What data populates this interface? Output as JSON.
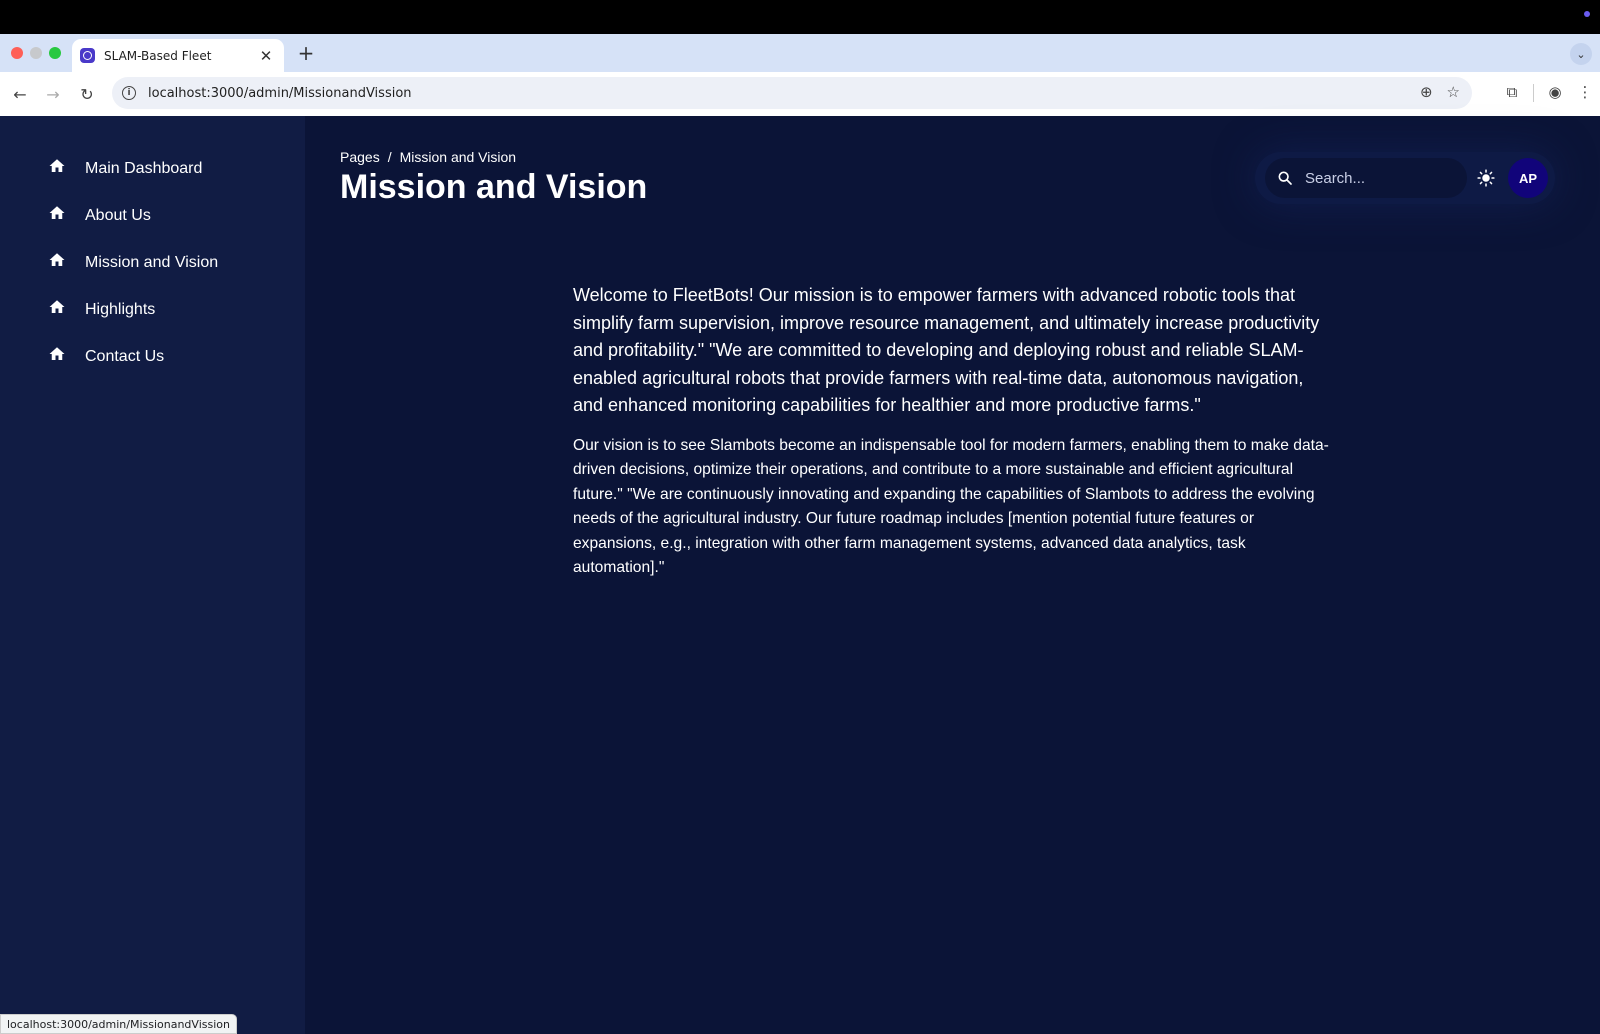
{
  "browser": {
    "tab_title": "SLAM-Based Fleet",
    "url": "localhost:3000/admin/MissionandVission",
    "status_url": "localhost:3000/admin/MissionandVission"
  },
  "sidebar": {
    "items": [
      {
        "label": "Main Dashboard",
        "icon": "home-icon"
      },
      {
        "label": "About Us",
        "icon": "home-icon"
      },
      {
        "label": "Mission and Vision",
        "icon": "home-icon"
      },
      {
        "label": "Highlights",
        "icon": "home-icon"
      },
      {
        "label": "Contact Us",
        "icon": "home-icon"
      }
    ]
  },
  "header": {
    "breadcrumb_root": "Pages",
    "breadcrumb_sep": "/",
    "breadcrumb_current": "Mission and Vision",
    "title": "Mission and Vision"
  },
  "search": {
    "placeholder": "Search..."
  },
  "user": {
    "initials": "AP"
  },
  "content": {
    "mission": "Welcome to FleetBots! Our mission is to empower farmers with advanced robotic tools that simplify farm supervision, improve resource management, and ultimately increase productivity and profitability.\" \"We are committed to developing and deploying robust and reliable SLAM-enabled agricultural robots that provide farmers with real-time data, autonomous navigation, and enhanced monitoring capabilities for healthier and more productive farms.\"",
    "vision": "Our vision is to see Slambots become an indispensable tool for modern farmers, enabling them to make data-driven decisions, optimize their operations, and contribute to a more sustainable and efficient agricultural future.\" \"We are continuously innovating and expanding the capabilities of Slambots to address the evolving needs of the agricultural industry. Our future roadmap includes [mention potential future features or expansions, e.g., integration with other farm management systems, advanced data analytics, task automation].\""
  },
  "colors": {
    "page_bg": "#0b1437",
    "sidebar_bg": "#111c44",
    "avatar_bg": "#11047a"
  }
}
